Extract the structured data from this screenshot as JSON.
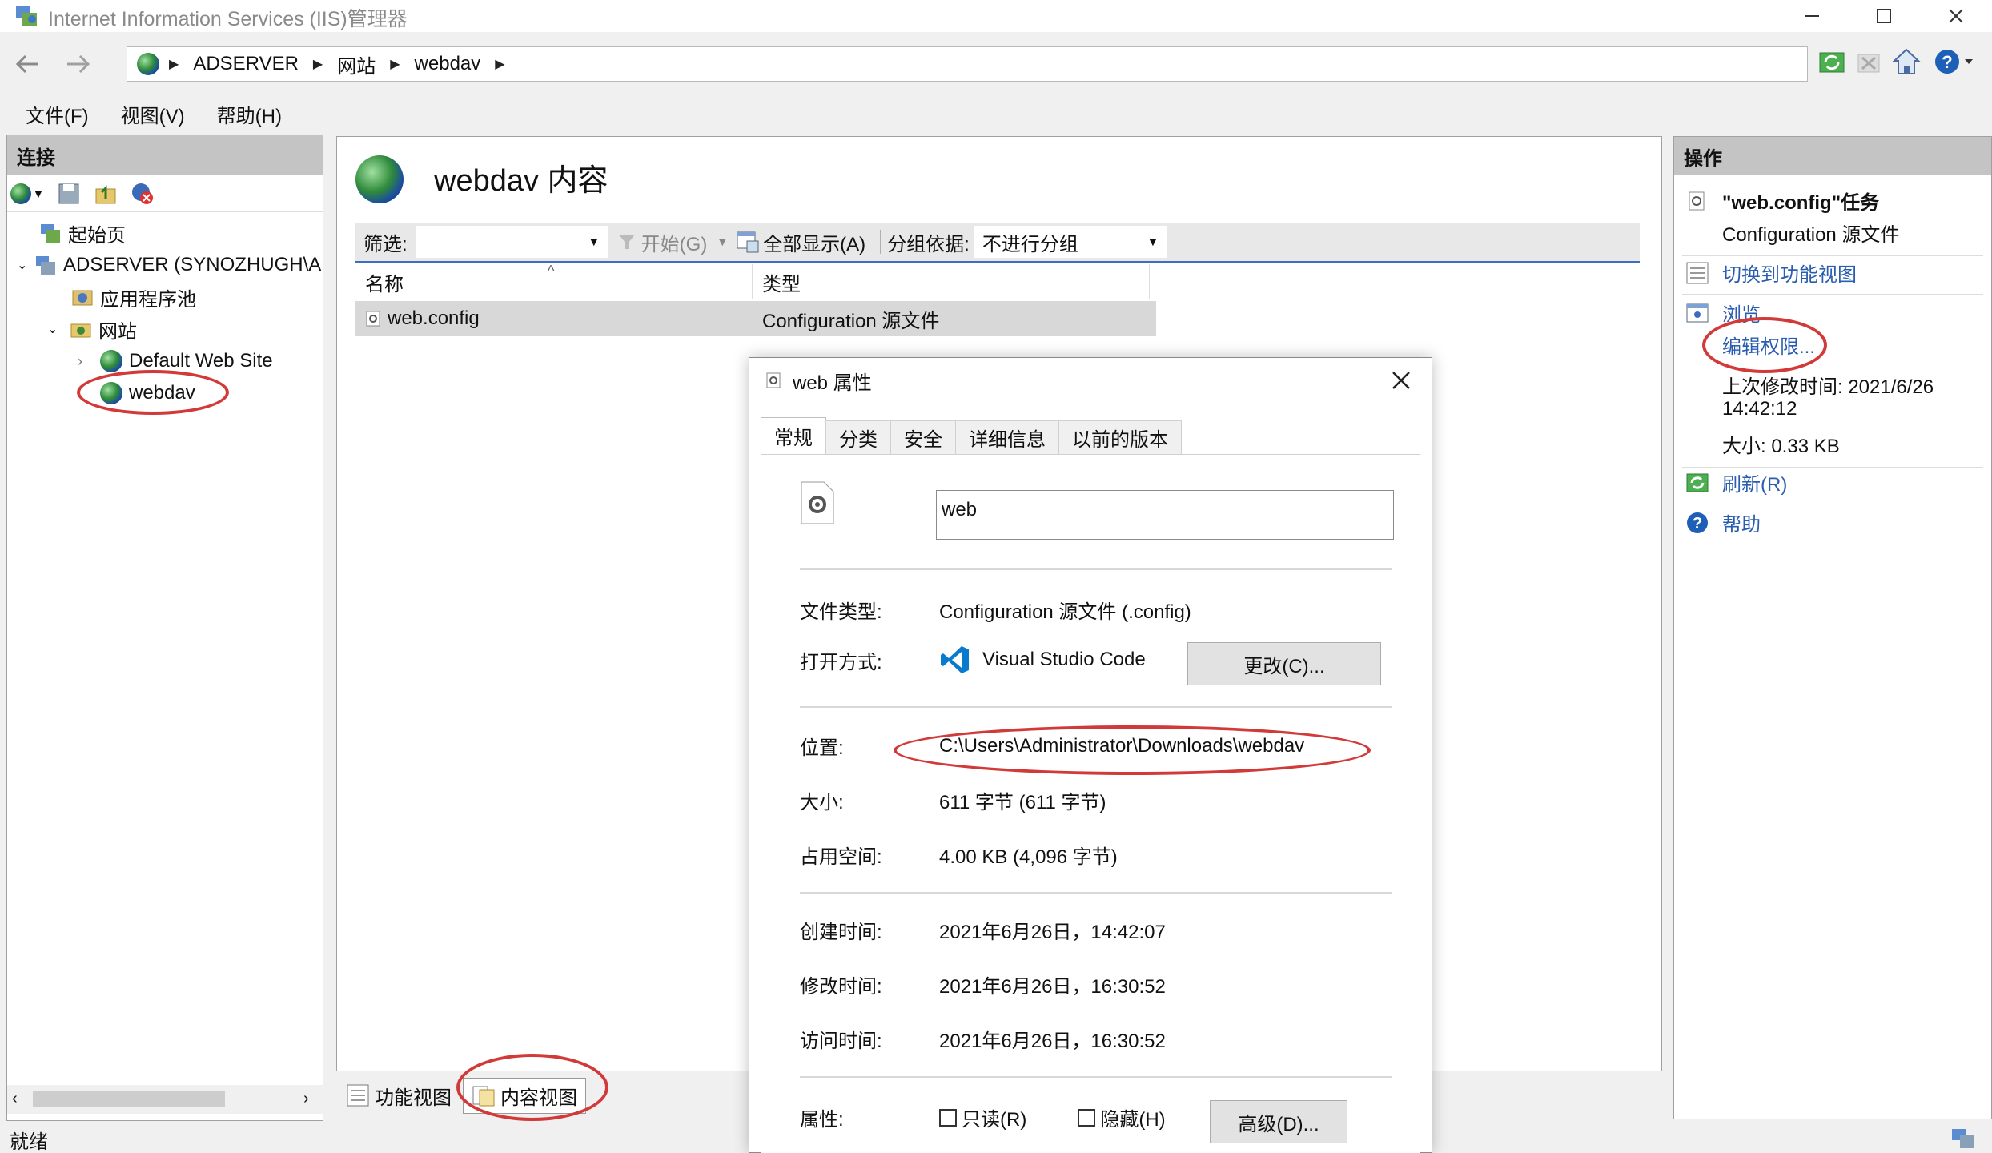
{
  "window": {
    "title": "Internet Information Services (IIS)管理器"
  },
  "address": {
    "crumbs": [
      "ADSERVER",
      "网站",
      "webdav"
    ]
  },
  "menu": [
    "文件(F)",
    "视图(V)",
    "帮助(H)"
  ],
  "connections": {
    "header": "连接",
    "tree": [
      {
        "label": "起始页"
      },
      {
        "label": "ADSERVER (SYNOZHUGH\\A"
      },
      {
        "label": "应用程序池"
      },
      {
        "label": "网站"
      },
      {
        "label": "Default Web Site"
      },
      {
        "label": "webdav"
      }
    ]
  },
  "center": {
    "title": "webdav 内容",
    "filter": {
      "label": "筛选:",
      "value": "",
      "start": "开始(G)",
      "show_all": "全部显示(A)",
      "group_label": "分组依据:",
      "group_value": "不进行分组"
    },
    "columns": [
      "名称",
      "类型"
    ],
    "rows": [
      {
        "name": "web.config",
        "type": "Configuration 源文件"
      }
    ],
    "view_tabs": [
      "功能视图",
      "内容视图"
    ]
  },
  "actions": {
    "header": "操作",
    "task_title": "\"web.config\"任务",
    "task_subtitle": "Configuration 源文件",
    "switch_view": "切换到功能视图",
    "browse": "浏览",
    "edit_permissions": "编辑权限...",
    "modified_label": "上次修改时间: 2021/6/26",
    "modified_time": "14:42:12",
    "size": "大小: 0.33 KB",
    "refresh": "刷新(R)",
    "help": "帮助"
  },
  "dialog": {
    "title": "web 属性",
    "tabs": [
      "常规",
      "分类",
      "安全",
      "详细信息",
      "以前的版本"
    ],
    "name_value": "web",
    "file_type_label": "文件类型:",
    "file_type": "Configuration 源文件 (.config)",
    "open_with_label": "打开方式:",
    "open_with": "Visual Studio Code",
    "change_button": "更改(C)...",
    "location_label": "位置:",
    "location": "C:\\Users\\Administrator\\Downloads\\webdav",
    "size_label": "大小:",
    "size": "611 字节 (611 字节)",
    "disk_label": "占用空间:",
    "disk": "4.00 KB (4,096 字节)",
    "created_label": "创建时间:",
    "created": "2021年6月26日，14:42:07",
    "modified_label": "修改时间:",
    "modified": "2021年6月26日，16:30:52",
    "accessed_label": "访问时间:",
    "accessed": "2021年6月26日，16:30:52",
    "attributes_label": "属性:",
    "readonly": "只读(R)",
    "hidden": "隐藏(H)",
    "advanced_button": "高级(D)..."
  },
  "status": {
    "text": "就绪"
  },
  "colors": {
    "annotation": "#d23a3a",
    "link": "#2a5db0",
    "panel_header": "#c4c4c4",
    "selected_row": "#d8d8d8"
  }
}
